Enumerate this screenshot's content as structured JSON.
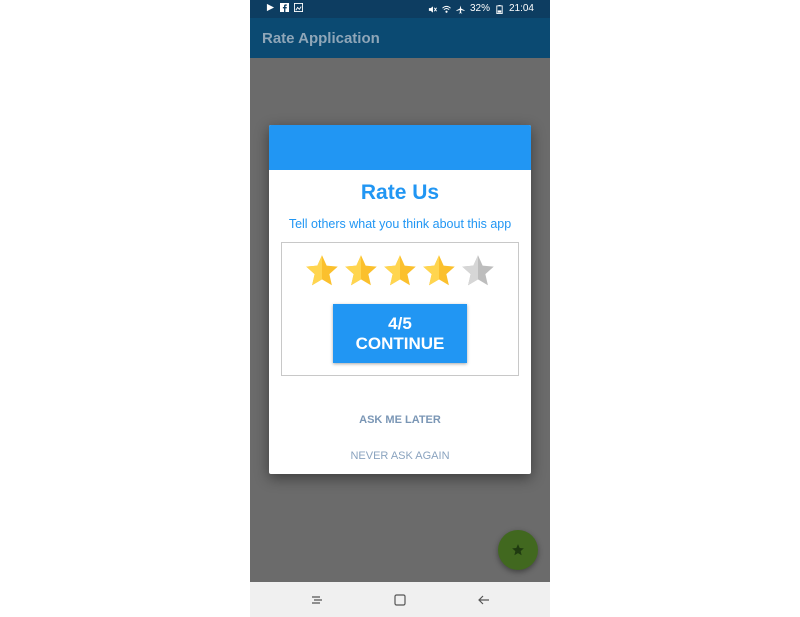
{
  "status_bar": {
    "battery": "32%",
    "time": "21:04"
  },
  "app_bar": {
    "title": "Rate Application"
  },
  "dialog": {
    "title": "Rate Us",
    "subtitle": "Tell others what you think about this app",
    "rating": {
      "value": 4,
      "max": 5
    },
    "continue_value": "4/5",
    "continue_label": "CONTINUE",
    "ask_later_label": "ASK ME LATER",
    "never_ask_label": "NEVER ASK AGAIN"
  },
  "fab": {
    "icon": "star-icon"
  },
  "nav_bar": {
    "icons": [
      "recent-apps-icon",
      "home-icon",
      "back-icon"
    ]
  },
  "colors": {
    "accent": "#2196f3",
    "status_bar": "#0d3d61",
    "app_bar": "#0b4a72",
    "scrim": "#6b6b6b",
    "star_filled": "#fbc02d",
    "star_empty": "#bdbdbd",
    "fab": "#41681f"
  }
}
